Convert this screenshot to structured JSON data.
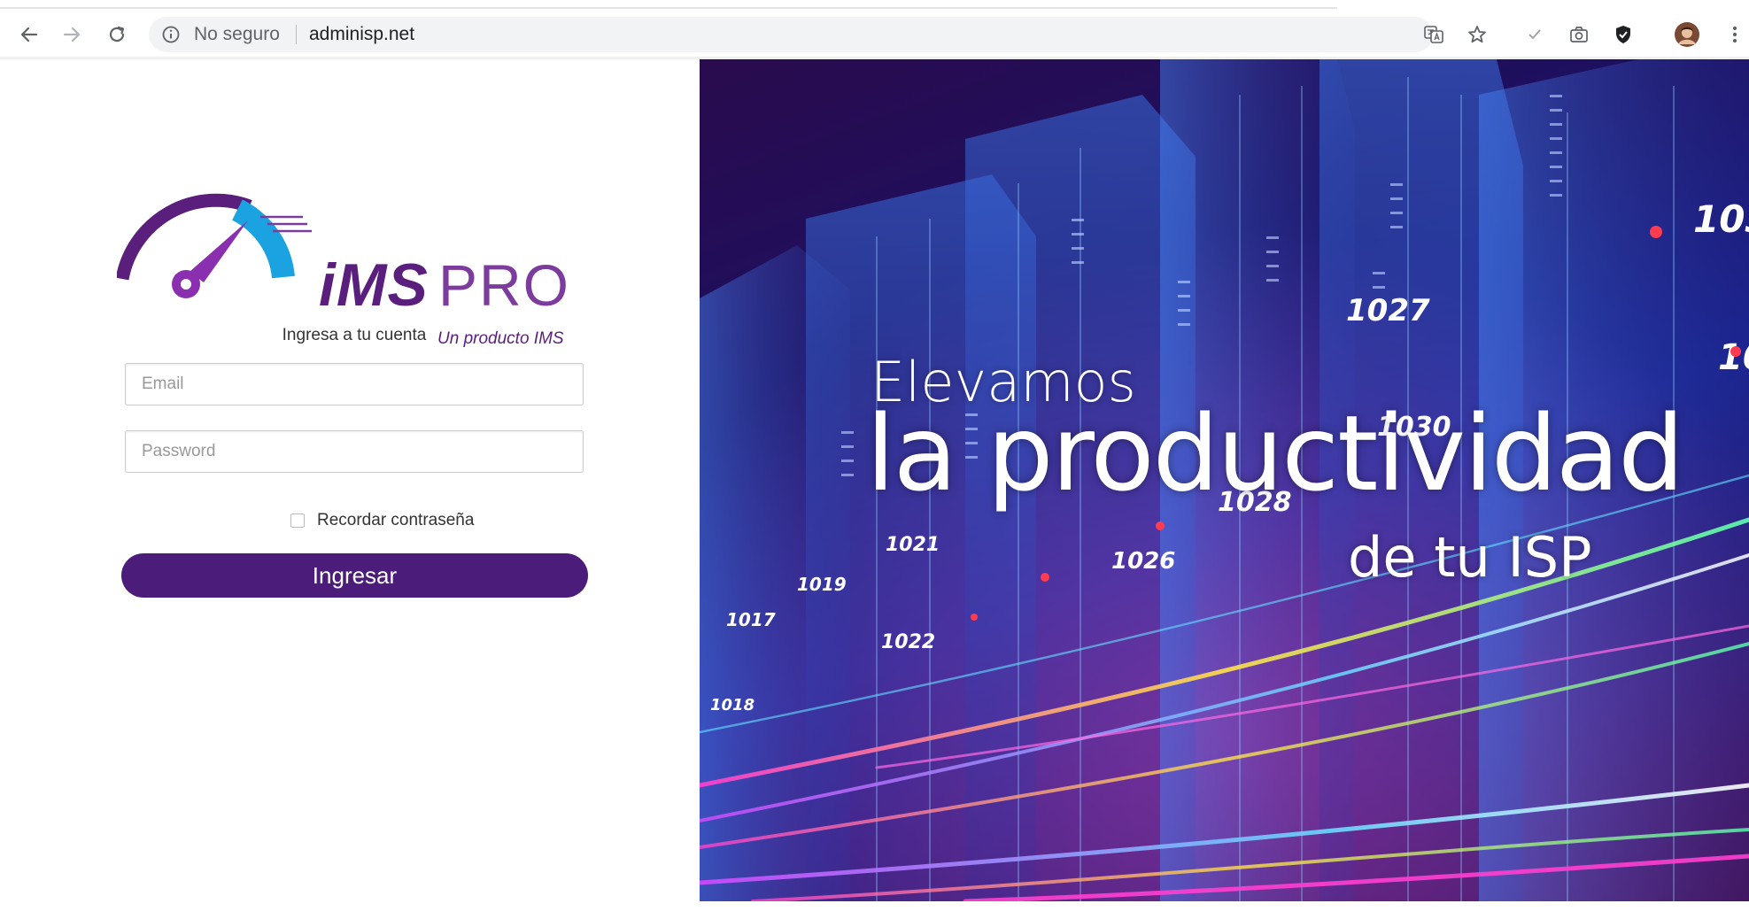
{
  "browser": {
    "security_text": "No seguro",
    "url": "adminisp.net"
  },
  "brand": {
    "logo_ims": "iMS",
    "logo_pro": "PRO",
    "tagline": "Un producto IMS"
  },
  "login": {
    "heading": "Ingresa a tu cuenta",
    "email_placeholder": "Email",
    "password_placeholder": "Password",
    "remember_label": "Recordar contraseña",
    "submit_label": "Ingresar"
  },
  "hero": {
    "line1": "Elevamos",
    "line2": "la productividad",
    "line3": "de tu ISP",
    "numbers": [
      "1017",
      "1019",
      "1021",
      "1022",
      "1026",
      "1028",
      "1027",
      "1018",
      "1030",
      "103",
      "10"
    ]
  },
  "colors": {
    "brand_purple": "#4b1c79",
    "logo_blue": "#1aa3e0"
  }
}
